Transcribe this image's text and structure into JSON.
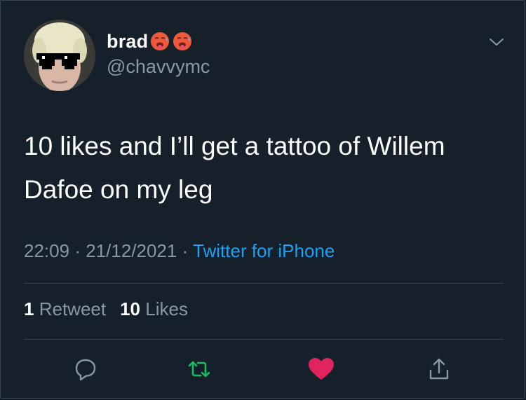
{
  "user": {
    "display_name": "brad",
    "handle": "@chavvymc",
    "name_emojis": [
      "hot-face-emoji",
      "hot-face-emoji"
    ]
  },
  "tweet": {
    "text": "10 likes and I’ll get a tattoo of Willem Dafoe on my leg",
    "time": "22:09",
    "date": "21/12/2021",
    "separator": "·",
    "source": "Twitter for iPhone"
  },
  "stats": {
    "retweets_count": "1",
    "retweets_label": "Retweet",
    "likes_count": "10",
    "likes_label": "Likes"
  },
  "actions": [
    "reply-icon",
    "retweet-icon",
    "like-icon",
    "share-icon"
  ],
  "colors": {
    "background": "#15202b",
    "secondary_text": "#8899a6",
    "link": "#1da1f2",
    "retweet": "#17bf63",
    "like": "#e0245e",
    "divider": "#38444d"
  }
}
